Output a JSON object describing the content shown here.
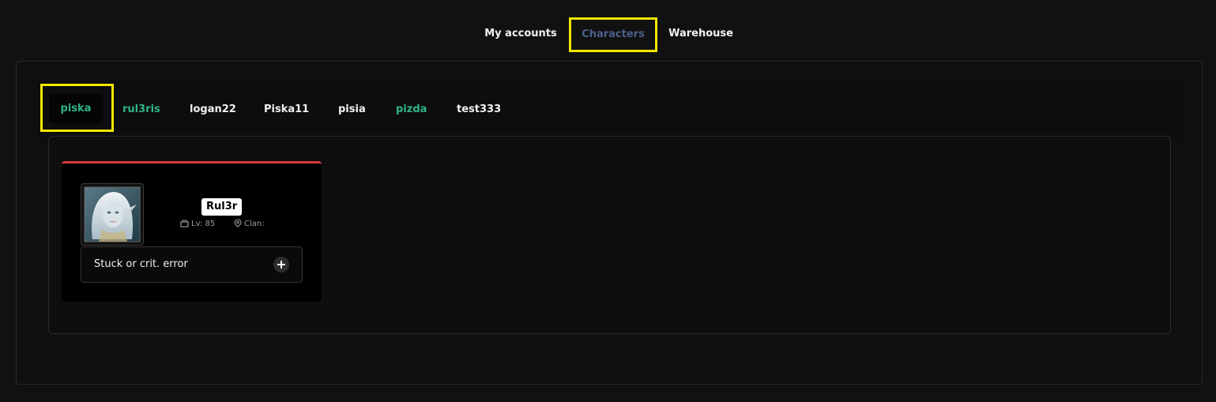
{
  "top_tabs": {
    "my_accounts": "My accounts",
    "characters": "Characters",
    "warehouse": "Warehouse"
  },
  "character_tabs": [
    {
      "label": "piska",
      "color": "#2fb38a",
      "selected": true
    },
    {
      "label": "rul3ris",
      "color": "#2fb38a"
    },
    {
      "label": "logan22",
      "color": "#f0f0f0"
    },
    {
      "label": "Piska11",
      "color": "#f0f0f0"
    },
    {
      "label": "pisia",
      "color": "#f0f0f0"
    },
    {
      "label": "pizda",
      "color": "#2fb38a"
    },
    {
      "label": "test333",
      "color": "#f0f0f0"
    }
  ],
  "card": {
    "accent_color": "#d33a3a",
    "name": "Rul3r",
    "level_text": "Lv: 85",
    "clan_text": "Clan:",
    "action_label": "Stuck or crit. error"
  },
  "colors": {
    "highlight_border": "#f2e600",
    "active_top_tab": "#4a5f8a",
    "green_name": "#2fb38a"
  }
}
